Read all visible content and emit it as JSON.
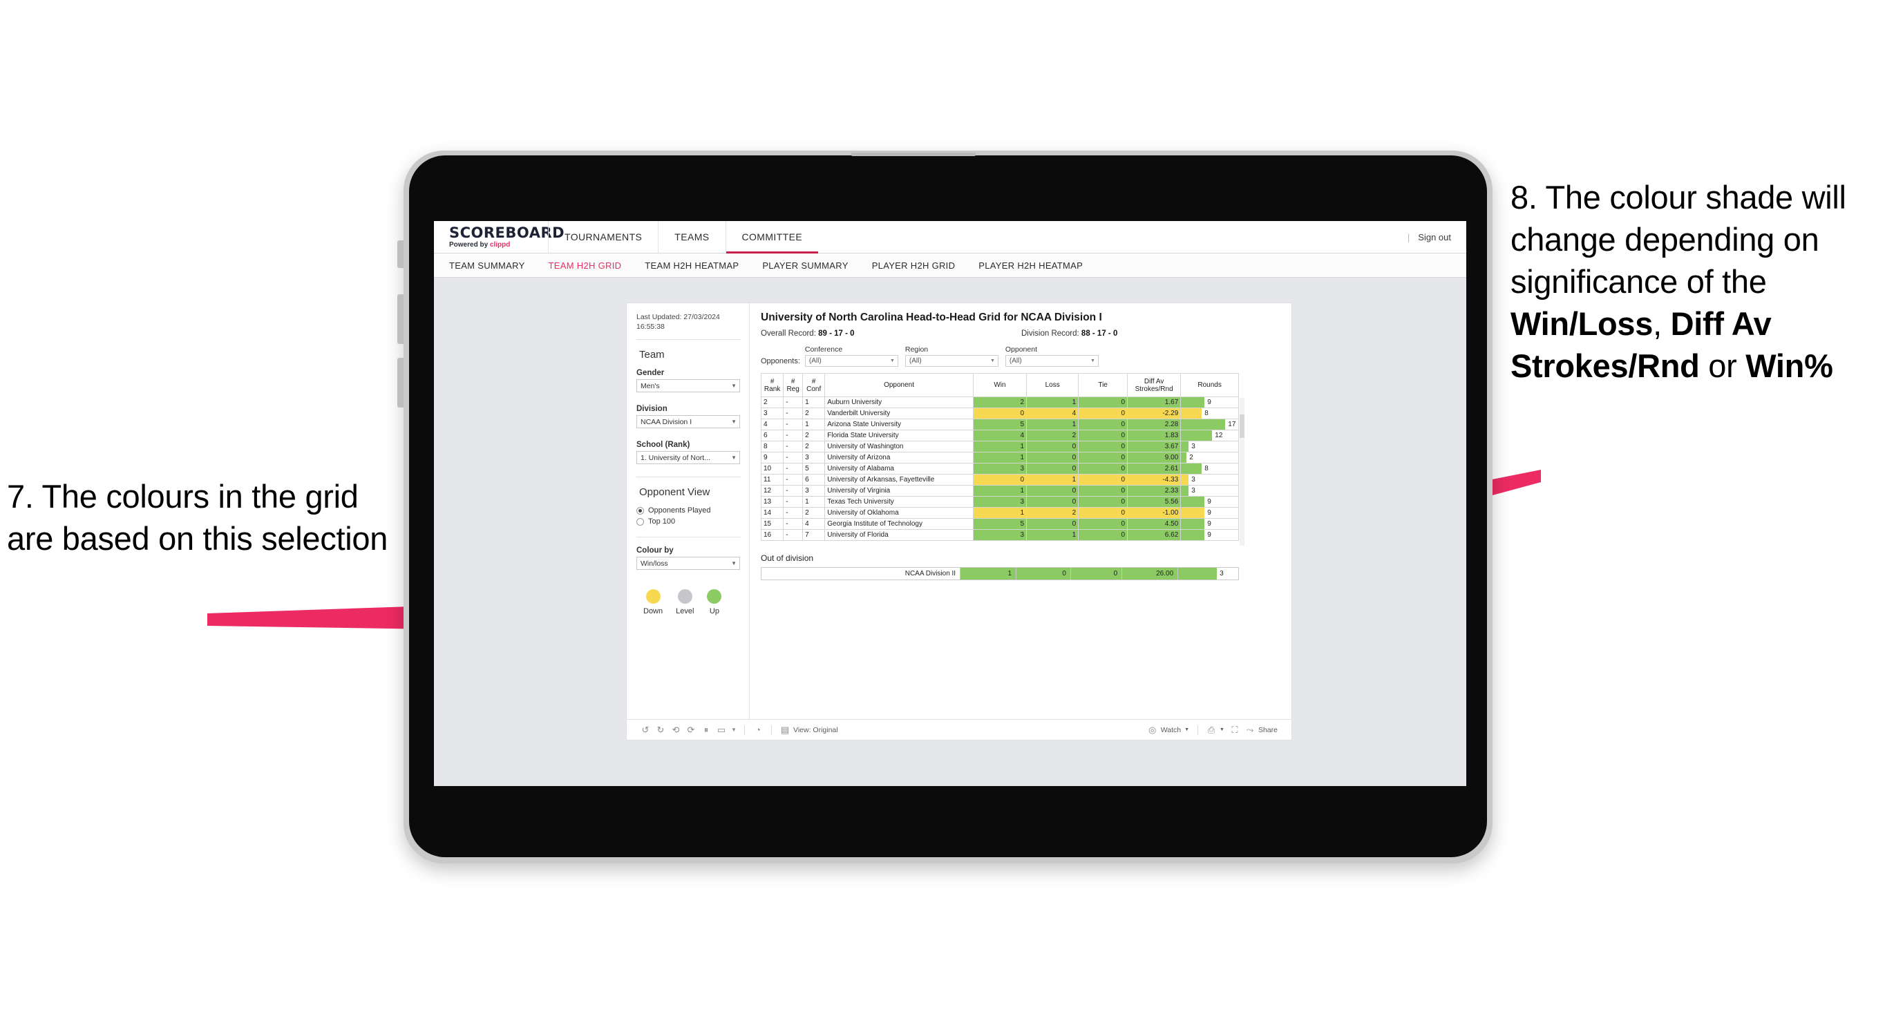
{
  "annotations": {
    "left": {
      "number": "7.",
      "text": "7. The colours in the grid are based on this selection"
    },
    "right": {
      "line1": "8. The colour shade will change depending on significance of the ",
      "bold1": "Win/Loss",
      "mid1": ", ",
      "bold2": "Diff Av Strokes/Rnd",
      "mid2": " or ",
      "bold3": "Win%"
    },
    "arrow_color": "#ec2b62"
  },
  "app": {
    "brand": {
      "name": "SCOREBOARD",
      "powered_prefix": "Powered by ",
      "powered_brand": "clippd"
    },
    "topnav": [
      {
        "label": "TOURNAMENTS",
        "active": false
      },
      {
        "label": "TEAMS",
        "active": false
      },
      {
        "label": "COMMITTEE",
        "active": true
      }
    ],
    "signout": {
      "divider": "|",
      "label": "Sign out"
    },
    "subnav": [
      {
        "label": "TEAM SUMMARY",
        "active": false
      },
      {
        "label": "TEAM H2H GRID",
        "active": true
      },
      {
        "label": "TEAM H2H HEATMAP",
        "active": false
      },
      {
        "label": "PLAYER SUMMARY",
        "active": false
      },
      {
        "label": "PLAYER H2H GRID",
        "active": false
      },
      {
        "label": "PLAYER H2H HEATMAP",
        "active": false
      }
    ]
  },
  "filters": {
    "last_updated": "Last Updated: 27/03/2024 16:55:38",
    "team_section": "Team",
    "gender": {
      "label": "Gender",
      "value": "Men's"
    },
    "division": {
      "label": "Division",
      "value": "NCAA Division I"
    },
    "school": {
      "label": "School (Rank)",
      "value": "1. University of Nort..."
    },
    "opponent_view": {
      "title": "Opponent View",
      "options": [
        {
          "label": "Opponents Played",
          "selected": true
        },
        {
          "label": "Top 100",
          "selected": false
        }
      ]
    },
    "colour_by": {
      "label": "Colour by",
      "value": "Win/loss"
    },
    "legend": [
      {
        "label": "Down",
        "color": "#f6d950"
      },
      {
        "label": "Level",
        "color": "#c4c6c9"
      },
      {
        "label": "Up",
        "color": "#8cca63"
      }
    ]
  },
  "main": {
    "title": "University of North Carolina Head-to-Head Grid for NCAA Division I",
    "overall_record_label": "Overall Record: ",
    "overall_record_value": "89 - 17 - 0",
    "division_record_label": "Division Record: ",
    "division_record_value": "88 - 17 - 0",
    "opponents_label": "Opponents:",
    "opponent_filters": [
      {
        "title": "Conference",
        "value": "(All)"
      },
      {
        "title": "Region",
        "value": "(All)"
      },
      {
        "title": "Opponent",
        "value": "(All)"
      }
    ],
    "columns": [
      {
        "l1": "#",
        "l2": "Rank"
      },
      {
        "l1": "#",
        "l2": "Reg"
      },
      {
        "l1": "#",
        "l2": "Conf"
      },
      {
        "l1": "Opponent",
        "l2": ""
      },
      {
        "l1": "Win",
        "l2": ""
      },
      {
        "l1": "Loss",
        "l2": ""
      },
      {
        "l1": "Tie",
        "l2": ""
      },
      {
        "l1": "Diff Av",
        "l2": "Strokes/Rnd"
      },
      {
        "l1": "Rounds",
        "l2": ""
      }
    ],
    "out_of_division_title": "Out of division",
    "out_of_division_row": {
      "name": "NCAA Division II",
      "win": "1",
      "loss": "0",
      "tie": "0",
      "diff": "26.00",
      "rounds": "3"
    }
  },
  "toolbar": {
    "view_label": "View: Original",
    "watch_label": "Watch",
    "share_label": "Share"
  },
  "chart_data": {
    "type": "table",
    "title": "University of North Carolina Head-to-Head Grid for NCAA Division I",
    "colour_by": "Win/loss",
    "colors": {
      "up": "#8cca63",
      "down": "#f6d950",
      "level": "#c4c6c9"
    },
    "columns": [
      "# Rank",
      "# Reg",
      "# Conf",
      "Opponent",
      "Win",
      "Loss",
      "Tie",
      "Diff Av Strokes/Rnd",
      "Rounds"
    ],
    "rounds_max": 17,
    "rows": [
      {
        "rank": "2",
        "reg": "-",
        "conf": "1",
        "opponent": "Auburn University",
        "win": "2",
        "loss": "1",
        "tie": "0",
        "diff": "1.67",
        "rounds": "9",
        "state": "up"
      },
      {
        "rank": "3",
        "reg": "-",
        "conf": "2",
        "opponent": "Vanderbilt University",
        "win": "0",
        "loss": "4",
        "tie": "0",
        "diff": "-2.29",
        "rounds": "8",
        "state": "down"
      },
      {
        "rank": "4",
        "reg": "-",
        "conf": "1",
        "opponent": "Arizona State University",
        "win": "5",
        "loss": "1",
        "tie": "0",
        "diff": "2.28",
        "rounds": "17",
        "state": "up"
      },
      {
        "rank": "6",
        "reg": "-",
        "conf": "2",
        "opponent": "Florida State University",
        "win": "4",
        "loss": "2",
        "tie": "0",
        "diff": "1.83",
        "rounds": "12",
        "state": "up"
      },
      {
        "rank": "8",
        "reg": "-",
        "conf": "2",
        "opponent": "University of Washington",
        "win": "1",
        "loss": "0",
        "tie": "0",
        "diff": "3.67",
        "rounds": "3",
        "state": "up"
      },
      {
        "rank": "9",
        "reg": "-",
        "conf": "3",
        "opponent": "University of Arizona",
        "win": "1",
        "loss": "0",
        "tie": "0",
        "diff": "9.00",
        "rounds": "2",
        "state": "up"
      },
      {
        "rank": "10",
        "reg": "-",
        "conf": "5",
        "opponent": "University of Alabama",
        "win": "3",
        "loss": "0",
        "tie": "0",
        "diff": "2.61",
        "rounds": "8",
        "state": "up"
      },
      {
        "rank": "11",
        "reg": "-",
        "conf": "6",
        "opponent": "University of Arkansas, Fayetteville",
        "win": "0",
        "loss": "1",
        "tie": "0",
        "diff": "-4.33",
        "rounds": "3",
        "state": "down"
      },
      {
        "rank": "12",
        "reg": "-",
        "conf": "3",
        "opponent": "University of Virginia",
        "win": "1",
        "loss": "0",
        "tie": "0",
        "diff": "2.33",
        "rounds": "3",
        "state": "up"
      },
      {
        "rank": "13",
        "reg": "-",
        "conf": "1",
        "opponent": "Texas Tech University",
        "win": "3",
        "loss": "0",
        "tie": "0",
        "diff": "5.56",
        "rounds": "9",
        "state": "up"
      },
      {
        "rank": "14",
        "reg": "-",
        "conf": "2",
        "opponent": "University of Oklahoma",
        "win": "1",
        "loss": "2",
        "tie": "0",
        "diff": "-1.00",
        "rounds": "9",
        "state": "down"
      },
      {
        "rank": "15",
        "reg": "-",
        "conf": "4",
        "opponent": "Georgia Institute of Technology",
        "win": "5",
        "loss": "0",
        "tie": "0",
        "diff": "4.50",
        "rounds": "9",
        "state": "up"
      },
      {
        "rank": "16",
        "reg": "-",
        "conf": "7",
        "opponent": "University of Florida",
        "win": "3",
        "loss": "1",
        "tie": "0",
        "diff": "6.62",
        "rounds": "9",
        "state": "up"
      }
    ],
    "out_of_division": [
      {
        "name": "NCAA Division II",
        "win": "1",
        "loss": "0",
        "tie": "0",
        "diff": "26.00",
        "rounds": "3",
        "state": "up"
      }
    ]
  }
}
